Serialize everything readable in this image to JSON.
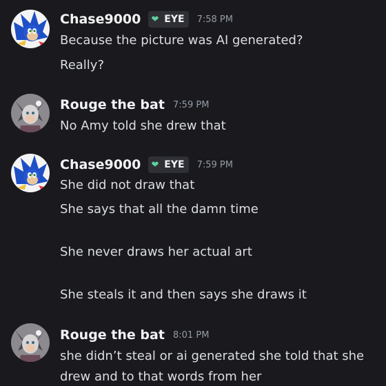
{
  "messages": [
    {
      "username": "Chase9000",
      "tag": {
        "icon": "green-heart-icon",
        "label": "EYE",
        "color": "#5dd39e"
      },
      "time": "7:58 PM",
      "lines": [
        "Because the picture was AI generated?",
        "Really?"
      ]
    },
    {
      "username": "Rouge the bat",
      "time": "7:59 PM",
      "lines": [
        "No Amy told she drew that"
      ]
    },
    {
      "username": "Chase9000",
      "tag": {
        "icon": "green-heart-icon",
        "label": "EYE",
        "color": "#5dd39e"
      },
      "time": "7:59 PM",
      "lines": [
        "She did not draw that",
        "She says that all the damn time",
        "She never draws her actual art",
        "She steals it and then says she draws it"
      ]
    },
    {
      "username": "Rouge the bat",
      "time": "8:01 PM",
      "lines": [
        "she didn’t steal or ai generated she told that she",
        "drew and to that words from her"
      ]
    }
  ],
  "colors": {
    "background": "#1a1a1e",
    "username": "#f2f3f5",
    "timestamp": "#949ba4",
    "message_text": "#dbdee1"
  }
}
